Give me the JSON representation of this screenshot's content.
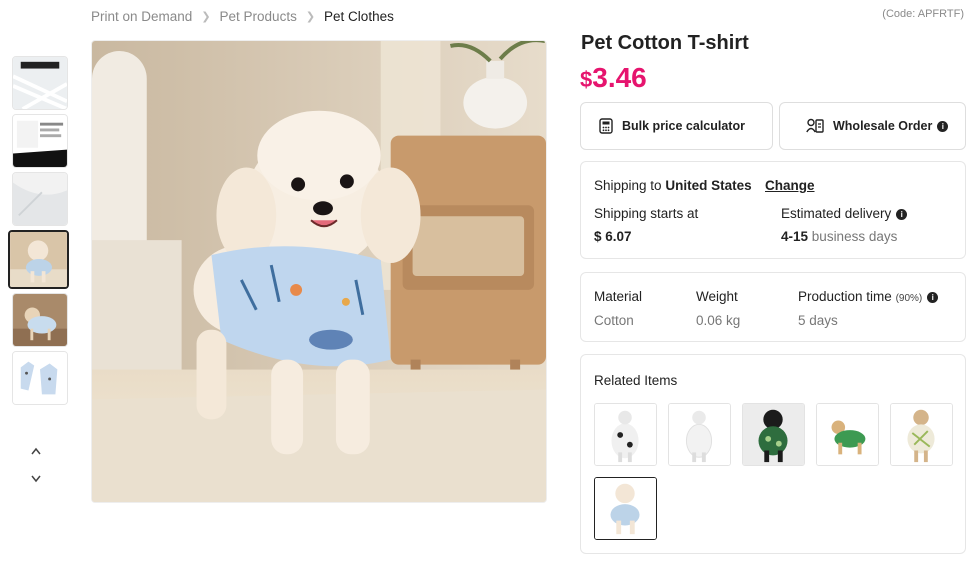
{
  "breadcrumb": {
    "items": [
      "Print on Demand",
      "Pet Products"
    ],
    "current": "Pet Clothes"
  },
  "product": {
    "code": "(Code: APFRTF)",
    "title": "Pet Cotton T-shirt",
    "currency": "$",
    "price": "3.46"
  },
  "buttons": {
    "bulk": "Bulk price calculator",
    "wholesale": "Wholesale Order"
  },
  "shipping": {
    "to_label": "Shipping to",
    "country": "United States",
    "change": "Change",
    "starts_label": "Shipping starts at",
    "starts_value": "$ 6.07",
    "delivery_label": "Estimated delivery",
    "delivery_range": "4-15",
    "delivery_unit": "business days"
  },
  "specs": {
    "material_label": "Material",
    "material_value": "Cotton",
    "weight_label": "Weight",
    "weight_value": "0.06 kg",
    "production_label": "Production time",
    "production_note": "(90%)",
    "production_value": "5 days"
  },
  "related": {
    "title": "Related Items"
  },
  "icons": {
    "bulk": "calculator-icon",
    "wholesale": "wholesale-list-icon",
    "info": "info-icon",
    "up": "chevron-up-icon",
    "down": "chevron-down-icon"
  },
  "colors": {
    "price": "#e6146e",
    "text": "#222222",
    "muted": "#8a8a8a"
  }
}
